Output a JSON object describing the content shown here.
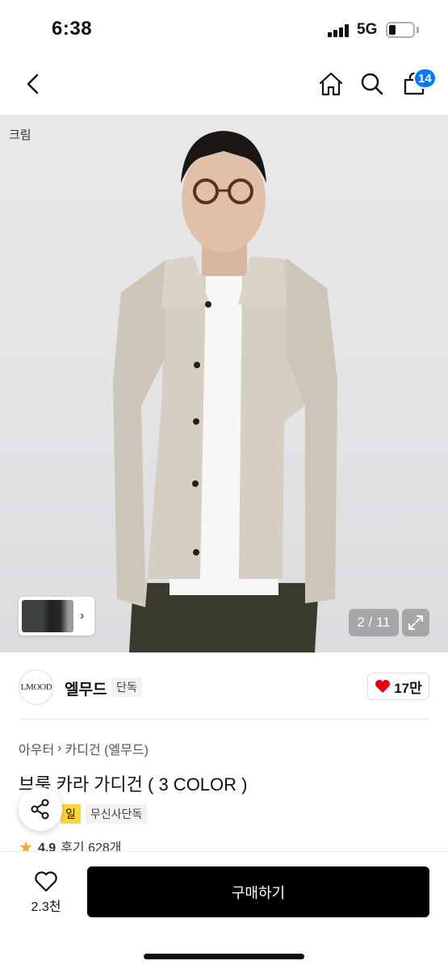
{
  "status": {
    "time": "6:38",
    "network": "5G",
    "battery_level": 0.3
  },
  "nav": {
    "cart_count": "14",
    "icons": [
      "chevron-left-icon",
      "home-icon",
      "search-icon",
      "cart-icon"
    ]
  },
  "gallery": {
    "color_label": "크림",
    "page_counter": "2 / 11",
    "current_page": 2,
    "total_pages": 11
  },
  "brand": {
    "logo_text": "LMOOD",
    "name": "엘무드",
    "tag": "단독",
    "likes": "17만",
    "heart_color": "#e60012"
  },
  "product": {
    "breadcrumb": [
      "아우터",
      "카디건 (엘무드)"
    ],
    "title": "브룩 카라 가디건 ( 3 COLOR )",
    "badge_yellow": "일",
    "badge_gray": "무신사단독",
    "rating": "4.9",
    "reviews": "후기 628개"
  },
  "bottom": {
    "wish_count": "2.3천",
    "buy_label": "구매하기"
  },
  "colors": {
    "accent": "#0078ff",
    "badge_yellow": "#ffd43b",
    "buy_button": "#000000"
  }
}
